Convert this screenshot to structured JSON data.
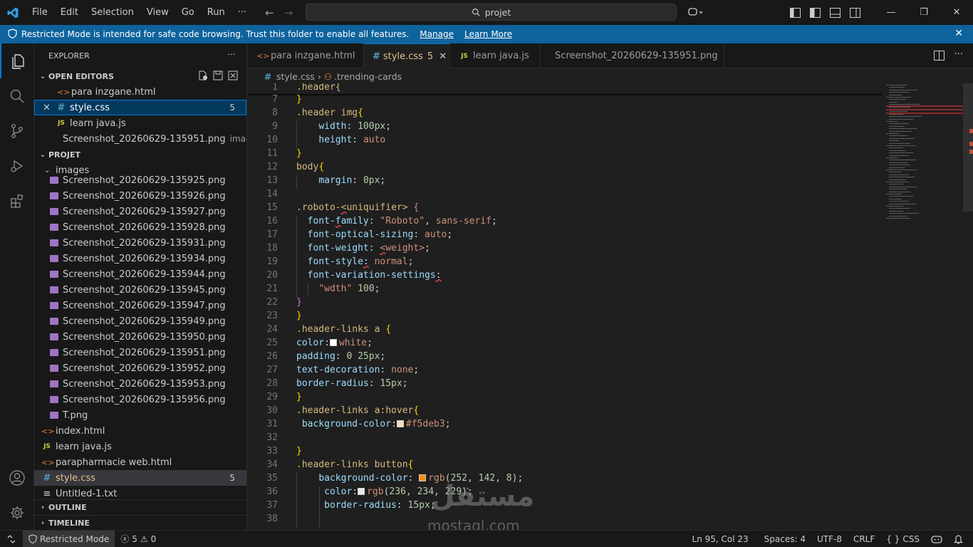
{
  "menu": {
    "items": [
      "File",
      "Edit",
      "Selection",
      "View",
      "Go",
      "Run",
      "···"
    ],
    "search_text": "projet"
  },
  "banner": {
    "text": "Restricted Mode is intended for safe code browsing. Trust this folder to enable all features.",
    "manage": "Manage",
    "learn_more": "Learn More"
  },
  "explorer": {
    "title": "EXPLORER",
    "open_editors_label": "OPEN EDITORS",
    "open_editors": [
      {
        "name": "para  inzgane.html",
        "icon": "html-icon"
      },
      {
        "name": "style.css",
        "icon": "css-icon",
        "badge": "5"
      },
      {
        "name": "learn java.js",
        "icon": "js-icon"
      },
      {
        "name": "Screenshot_20260629-135951.png",
        "icon": "image-icon",
        "desc": "images"
      }
    ],
    "project_label": "PROJET",
    "folder_label": "images",
    "images": [
      "Screenshot_20260629-135925.png",
      "Screenshot_20260629-135926.png",
      "Screenshot_20260629-135927.png",
      "Screenshot_20260629-135928.png",
      "Screenshot_20260629-135931.png",
      "Screenshot_20260629-135934.png",
      "Screenshot_20260629-135944.png",
      "Screenshot_20260629-135945.png",
      "Screenshot_20260629-135947.png",
      "Screenshot_20260629-135949.png",
      "Screenshot_20260629-135950.png",
      "Screenshot_20260629-135951.png",
      "Screenshot_20260629-135952.png",
      "Screenshot_20260629-135953.png",
      "Screenshot_20260629-135956.png",
      "T.png"
    ],
    "files": [
      {
        "name": "index.html",
        "icon": "html-icon"
      },
      {
        "name": "learn java.js",
        "icon": "js-icon"
      },
      {
        "name": "parapharmacie web.html",
        "icon": "html-icon"
      },
      {
        "name": "style.css",
        "icon": "css-icon",
        "badge": "5"
      },
      {
        "name": "Untitled-1.txt",
        "icon": "text-icon"
      }
    ],
    "outline_label": "OUTLINE",
    "timeline_label": "TIMELINE"
  },
  "tabs": [
    {
      "label": "para inzgane.html",
      "icon": "html-icon"
    },
    {
      "label": "style.css",
      "icon": "css-icon",
      "count": "5",
      "active": true
    },
    {
      "label": "learn java.js",
      "icon": "js-icon"
    },
    {
      "label": "Screenshot_20260629-135951.png",
      "icon": "image-icon"
    }
  ],
  "breadcrumb": {
    "file": "style.css",
    "symbol": ".trending-cards"
  },
  "editor": {
    "sticky_line_number": "1",
    "sticky_text": ".header{",
    "line_numbers": [
      "7",
      "8",
      "9",
      "10",
      "11",
      "12",
      "13",
      "14",
      "15",
      "16",
      "17",
      "18",
      "19",
      "20",
      "21",
      "22",
      "23",
      "24",
      "25",
      "26",
      "27",
      "28",
      "29",
      "30",
      "31",
      "32",
      "33",
      "34",
      "35",
      "36",
      "37",
      "38"
    ],
    "color_swatches": {
      "white": "#ffffff",
      "f5deb3": "#f5deb3",
      "orange": "#fc8e08",
      "light": "#ece9e5"
    }
  },
  "watermark": {
    "arabic": "مستقل",
    "latin": "mostaql.com"
  },
  "status": {
    "restricted": "Restricted Mode",
    "errors": "5",
    "warnings": "0",
    "position": "Ln 95, Col 23",
    "spaces": "Spaces: 4",
    "encoding": "UTF-8",
    "eol": "CRLF",
    "language": "CSS"
  },
  "colors": {
    "accent": "#0078d4",
    "banner": "#0e639c",
    "modified": "#e2c08d"
  }
}
